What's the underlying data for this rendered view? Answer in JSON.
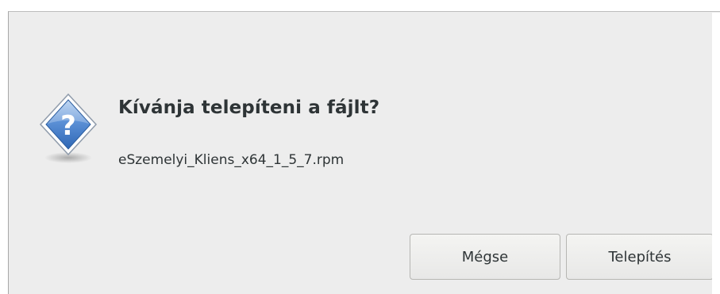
{
  "dialog": {
    "icon": "question-icon",
    "title": "Kívánja telepíteni a fájlt?",
    "filename": "eSzemelyi_Kliens_x64_1_5_7.rpm",
    "cancel_label": "Mégse",
    "install_label": "Telepítés"
  },
  "colors": {
    "background": "#ededed",
    "text": "#2e3436",
    "icon_blue": "#3f79c4"
  }
}
